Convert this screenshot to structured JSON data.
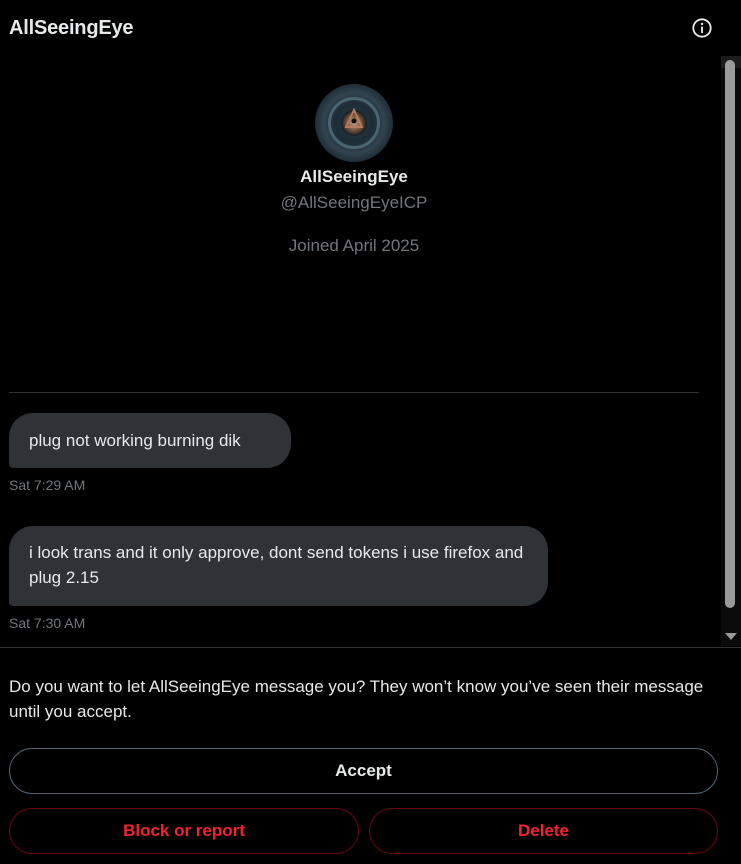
{
  "header": {
    "title": "AllSeeingEye",
    "info_icon": "info-circle-icon"
  },
  "profile": {
    "name": "AllSeeingEye",
    "handle": "@AllSeeingEyeICP",
    "joined": "Joined April 2025"
  },
  "messages": [
    {
      "text": "plug not working burning dik",
      "time": "Sat 7:29 AM"
    },
    {
      "text": "i look trans and it only approve, dont send tokens i use firefox and plug 2.15",
      "time": "Sat 7:30 AM"
    }
  ],
  "request": {
    "prompt": "Do you want to let AllSeeingEye message you? They won’t know you’ve seen their message until you accept.",
    "accept_label": "Accept",
    "block_label": "Block or report",
    "delete_label": "Delete"
  },
  "colors": {
    "background": "#000000",
    "bubble": "#2f3336",
    "muted_text": "#71767b",
    "danger": "#f4212e"
  }
}
